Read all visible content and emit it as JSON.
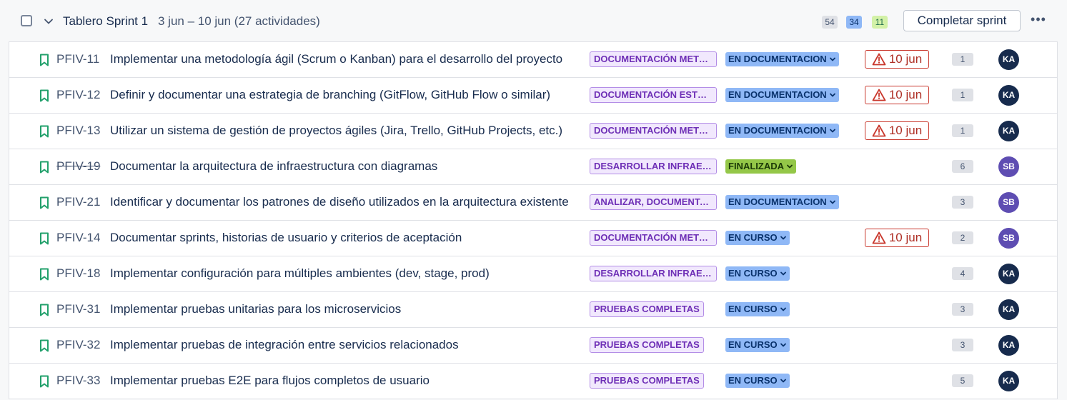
{
  "sprint": {
    "title": "Tablero Sprint 1",
    "dates": "3 jun – 10 jun (27 actividades)",
    "counts": {
      "todo": "54",
      "in_progress": "34",
      "done": "11"
    },
    "complete_label": "Completar sprint",
    "more_label": "•••"
  },
  "colors": {
    "status_blue": "#8fb8f6",
    "status_green": "#94c748",
    "epic_purple": "#6e2fb6",
    "overdue_red": "#c9372c",
    "bookmark_green": "#22a06b"
  },
  "icons": {
    "checkbox": "checkbox-icon",
    "chevron": "chevron-down-icon",
    "story": "bookmark-icon",
    "overdue": "warning-icon"
  },
  "issues": [
    {
      "key": "PFIV-11",
      "summary": "Implementar una metodología ágil (Scrum o Kanban) para el desarrollo del proyecto",
      "epic": "DOCUMENTACIÓN METODOLOGÍA ÁGIL",
      "status": "EN DOCUMENTACION",
      "due": "10 jun",
      "points": "1",
      "assignee": "KA"
    },
    {
      "key": "PFIV-12",
      "summary": "Definir y documentar una estrategia de branching (GitFlow, GitHub Flow o similar)",
      "epic": "DOCUMENTACIÓN ESTRATEGIA DE BRANCHING",
      "status": "EN DOCUMENTACION",
      "due": "10 jun",
      "points": "1",
      "assignee": "KA"
    },
    {
      "key": "PFIV-13",
      "summary": "Utilizar un sistema de gestión de proyectos ágiles (Jira, Trello, GitHub Projects, etc.)",
      "epic": "DOCUMENTACIÓN METODOLOGÍA ÁGIL",
      "status": "EN DOCUMENTACION",
      "due": "10 jun",
      "points": "1",
      "assignee": "KA"
    },
    {
      "key": "PFIV-19",
      "summary": "Documentar la arquitectura de infraestructura con diagramas",
      "epic": "DESARROLLAR INFRAESTRUCTURA",
      "status": "FINALIZADA",
      "due": "",
      "points": "6",
      "assignee": "SB"
    },
    {
      "key": "PFIV-21",
      "summary": "Identificar y documentar los patrones de diseño utilizados en la arquitectura existente",
      "epic": "ANALIZAR, DOCUMENTAR Y MEJORAR",
      "status": "EN DOCUMENTACION",
      "due": "",
      "points": "3",
      "assignee": "SB"
    },
    {
      "key": "PFIV-14",
      "summary": "Documentar sprints, historias de usuario y criterios de aceptación",
      "epic": "DOCUMENTACIÓN METODOLOGÍA ÁGIL",
      "status": "EN CURSO",
      "due": "10 jun",
      "points": "2",
      "assignee": "SB"
    },
    {
      "key": "PFIV-18",
      "summary": "Implementar configuración para múltiples ambientes (dev, stage, prod)",
      "epic": "DESARROLLAR INFRAESTRUCTURA",
      "status": "EN CURSO",
      "due": "",
      "points": "4",
      "assignee": "KA"
    },
    {
      "key": "PFIV-31",
      "summary": "Implementar pruebas unitarias para los microservicios",
      "epic": "PRUEBAS COMPLETAS",
      "status": "EN CURSO",
      "due": "",
      "points": "3",
      "assignee": "KA"
    },
    {
      "key": "PFIV-32",
      "summary": "Implementar pruebas de integración entre servicios relacionados",
      "epic": "PRUEBAS COMPLETAS",
      "status": "EN CURSO",
      "due": "",
      "points": "3",
      "assignee": "KA"
    },
    {
      "key": "PFIV-33",
      "summary": "Implementar pruebas E2E para flujos completos de usuario",
      "epic": "PRUEBAS COMPLETAS",
      "status": "EN CURSO",
      "due": "",
      "points": "5",
      "assignee": "KA"
    }
  ]
}
